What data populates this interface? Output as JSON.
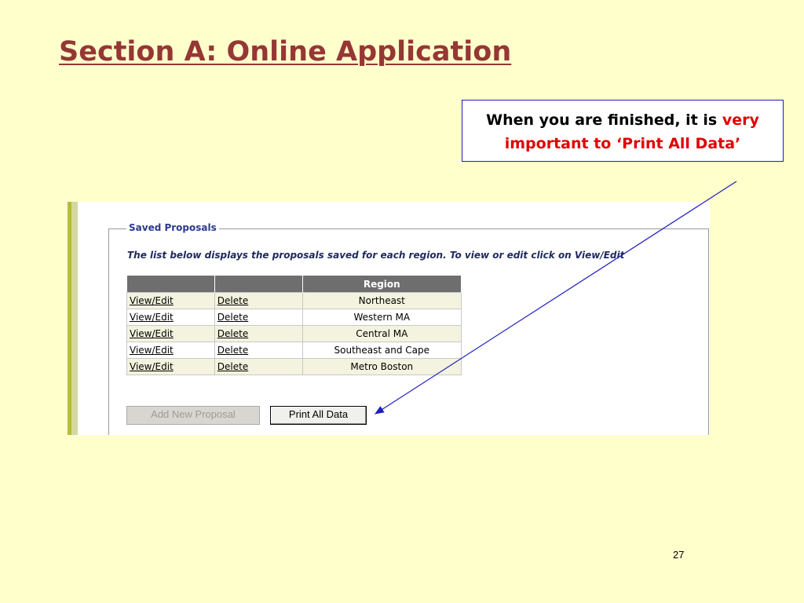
{
  "slide": {
    "title": "Section A: Online Application",
    "callout": {
      "part1": "When you are finished, it is ",
      "emphasis_line1": "very",
      "emphasis_line2": "important to ‘Print All Data’"
    },
    "page_number": "27"
  },
  "saved_proposals": {
    "legend": "Saved Proposals",
    "intro": "The list below displays the proposals saved for each region. To view or edit click on View/Edit",
    "table": {
      "headers": [
        "",
        "",
        "Region"
      ],
      "rows": [
        {
          "view": "View/Edit",
          "delete": "Delete",
          "region": "Northeast"
        },
        {
          "view": "View/Edit",
          "delete": "Delete",
          "region": "Western MA"
        },
        {
          "view": "View/Edit",
          "delete": "Delete",
          "region": "Central MA"
        },
        {
          "view": "View/Edit",
          "delete": "Delete",
          "region": "Southeast and Cape"
        },
        {
          "view": "View/Edit",
          "delete": "Delete",
          "region": "Metro Boston"
        }
      ]
    },
    "buttons": {
      "add_new": "Add New Proposal",
      "print_all": "Print All Data"
    }
  },
  "colors": {
    "background": "#FFFFCC",
    "title": "#953735",
    "emphasis": "#E00000",
    "arrow": "#1F1FBF"
  }
}
